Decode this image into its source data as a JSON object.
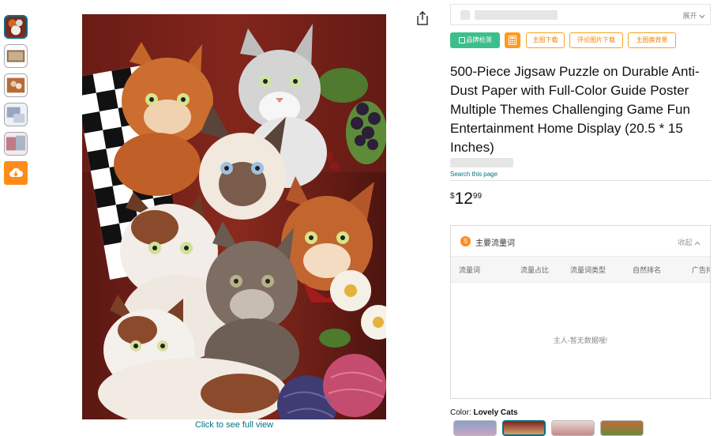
{
  "gallery": {
    "click_full_view": "Click to see full view"
  },
  "header": {
    "expand_label": "展开"
  },
  "tags": {
    "brand_check": "品牌检测",
    "main_image_download": "主图下载",
    "review_image_download": "评论图片下载",
    "main_image_bg": "主图换背景"
  },
  "product": {
    "title": "500-Piece Jigsaw Puzzle on Durable Anti-Dust Paper with Full-Color Guide Poster Multiple Themes Challenging Game Fun Entertainment Home Display (20.5 * 15 Inches)",
    "search_link": "Search this page",
    "price": {
      "currency": "$",
      "whole": "12",
      "fraction": "99"
    }
  },
  "traffic_panel": {
    "title": "主要流量词",
    "collapse_label": "收起",
    "columns": [
      "流量词",
      "流量占比",
      "流量词类型",
      "自然排名",
      "广告排"
    ],
    "empty_text": "主人-暂无数据哦!"
  },
  "color": {
    "label": "Color:",
    "selected": "Lovely Cats"
  },
  "icons": [
    "share-icon",
    "cloud-download-icon",
    "calculator-icon",
    "shield-icon",
    "chevron-up-icon",
    "chevron-down-icon"
  ],
  "accent_colors": {
    "link": "#007185",
    "orange": "#ff8c1a",
    "green": "#3dbf8b"
  }
}
